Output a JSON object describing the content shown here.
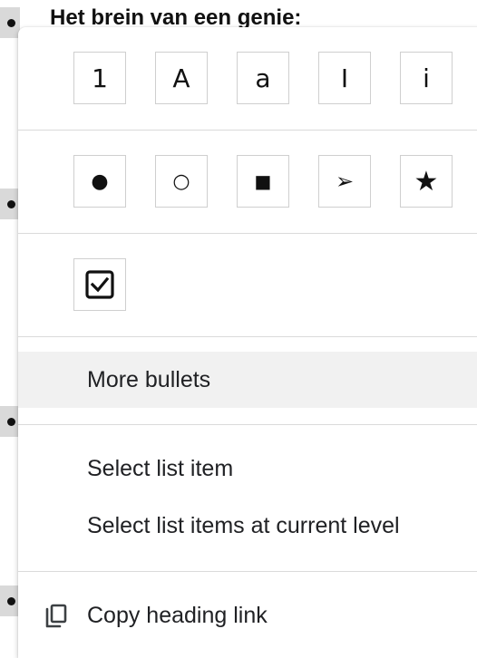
{
  "document": {
    "heading": "Het brein van een genie:"
  },
  "menu": {
    "numbering_options": [
      {
        "label": "1",
        "name": "numbering-decimal-button"
      },
      {
        "label": "A",
        "name": "numbering-upper-alpha-button"
      },
      {
        "label": "a",
        "name": "numbering-lower-alpha-button"
      },
      {
        "label": "I",
        "name": "numbering-upper-roman-button"
      },
      {
        "label": "i",
        "name": "numbering-lower-roman-button"
      }
    ],
    "bullet_options": [
      {
        "label": "●",
        "name": "bullet-filled-circle-button"
      },
      {
        "label": "○",
        "name": "bullet-hollow-circle-button"
      },
      {
        "label": "■",
        "name": "bullet-square-button"
      },
      {
        "label": "➢",
        "name": "bullet-arrow-button"
      },
      {
        "label": "★",
        "name": "bullet-star-button"
      }
    ],
    "checklist_option": {
      "name": "checkbox-bullet-button",
      "icon": "checkbox-checked-icon"
    },
    "more_bullets": "More bullets",
    "select_list_item": "Select list item",
    "select_list_items_level": "Select list items at current level",
    "copy_heading_link": "Copy heading link"
  }
}
